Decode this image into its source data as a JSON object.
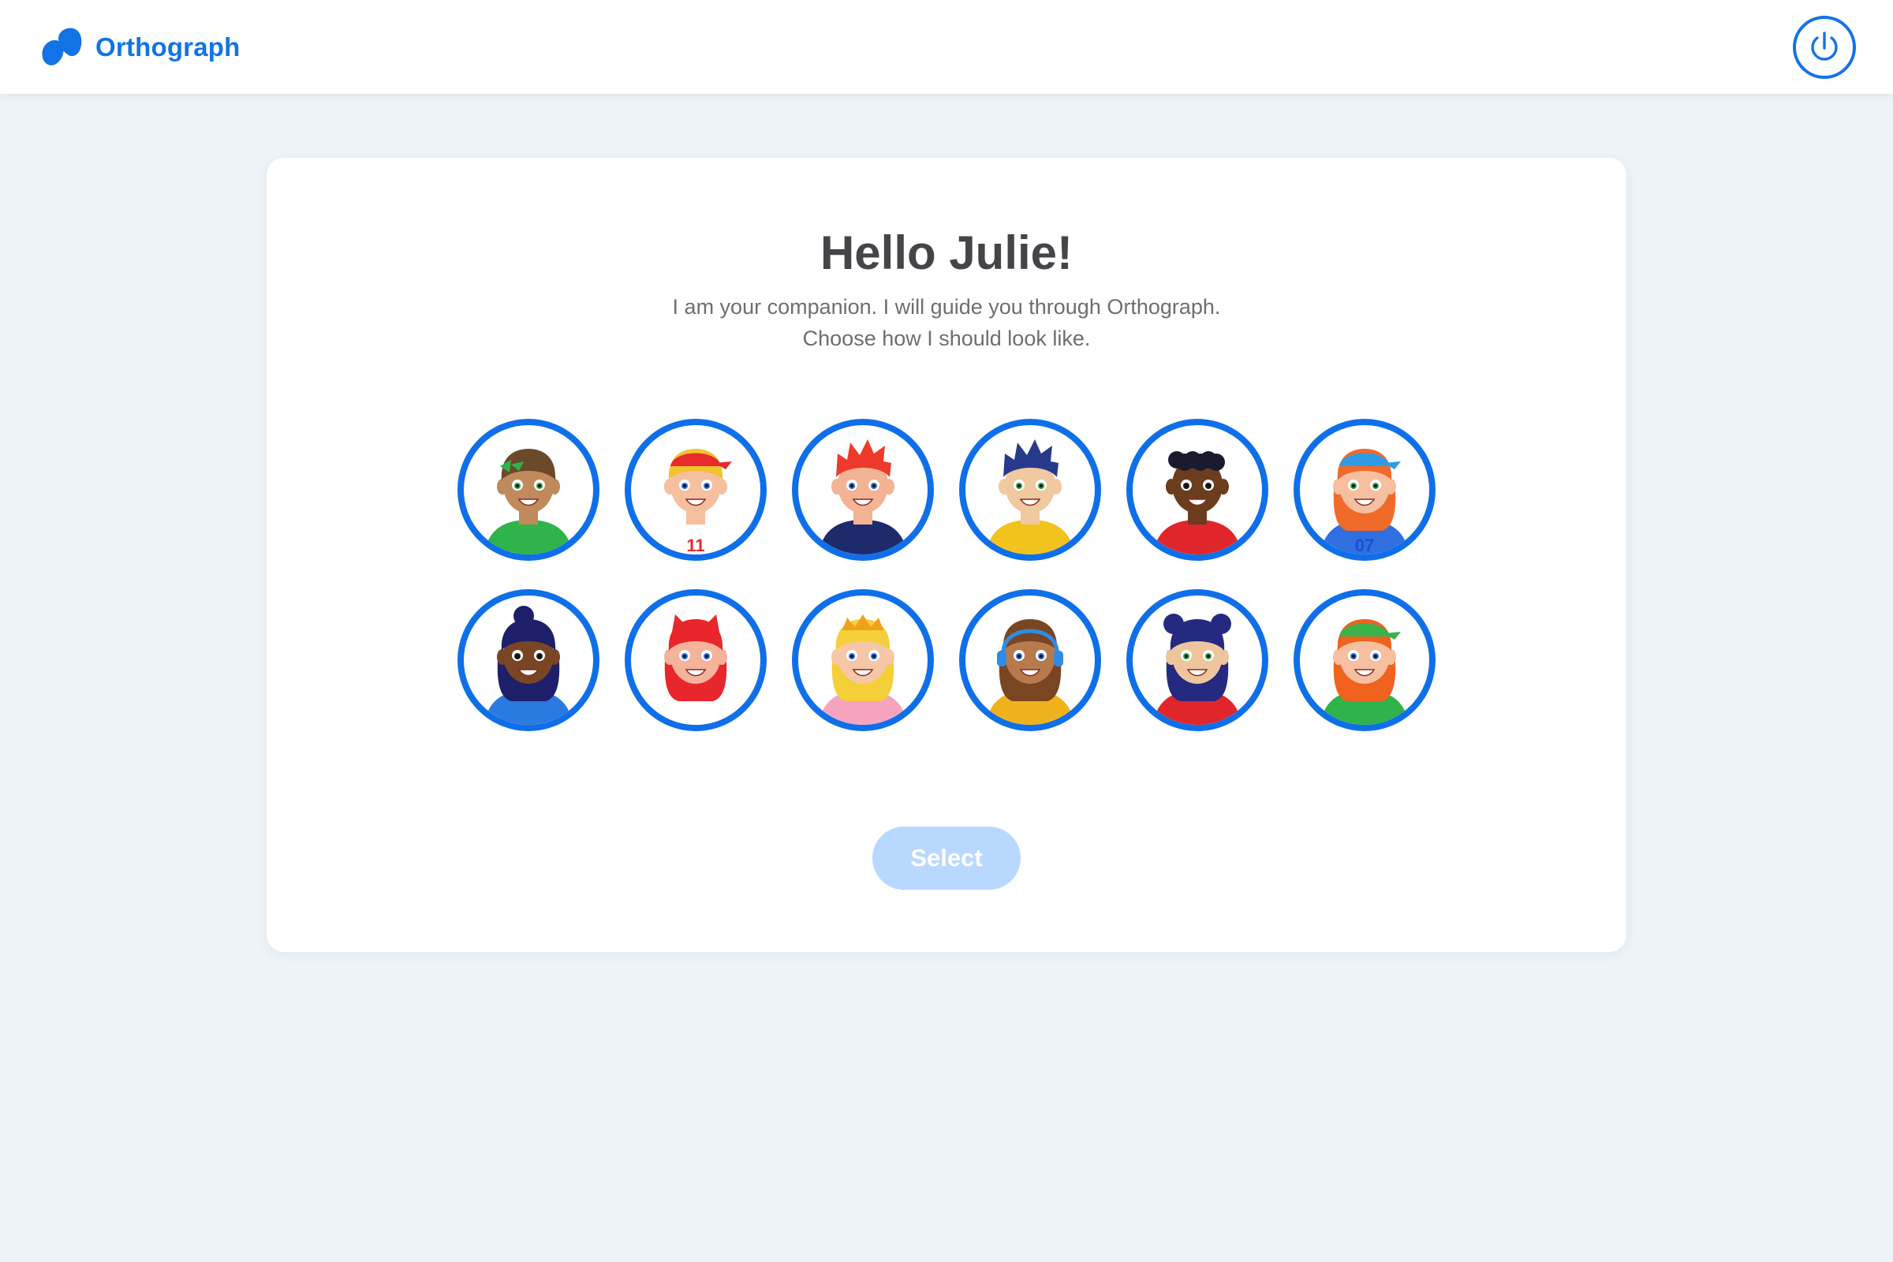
{
  "app": {
    "name": "Orthograph",
    "brand_color": "#1273e6",
    "power_icon": "power-icon"
  },
  "greeting": {
    "title": "Hello Julie!",
    "line1": "I am your companion. I will guide you through Orthograph.",
    "line2": "Choose how I should look like."
  },
  "avatars": [
    {
      "skin": "#c08a5c",
      "hair": "#6b4a2a",
      "top": "#2fb34a",
      "accent": "#2fb34a",
      "eyes": "#2e9e4a",
      "style": "bow"
    },
    {
      "skin": "#f6bfa0",
      "hair": "#f2c230",
      "top": "#ffffff",
      "accent": "#e52b2b",
      "eyes": "#2a6fd6",
      "style": "cap-side",
      "jersey": "11"
    },
    {
      "skin": "#f3b394",
      "hair": "#ee3a2a",
      "top": "#1d2a6b",
      "accent": "#ffffff",
      "eyes": "#2a6fd6",
      "style": "spiky"
    },
    {
      "skin": "#f0c9a0",
      "hair": "#273a8c",
      "top": "#f2c21d",
      "accent": "#3fb24a",
      "eyes": "#2e9e4a",
      "style": "spiky"
    },
    {
      "skin": "#6b3c1e",
      "hair": "#1b1b2e",
      "top": "#e0262b",
      "accent": "#b01e22",
      "eyes": "#1b1b1b",
      "style": "curly"
    },
    {
      "skin": "#f6bfa0",
      "hair": "#f06a2a",
      "top": "#2f6fe0",
      "accent": "#2f9be6",
      "eyes": "#2e9e4a",
      "style": "cap",
      "jersey": "07"
    },
    {
      "skin": "#7a4524",
      "hair": "#1d1f6a",
      "top": "#2a7ae0",
      "accent": "#ffffff",
      "eyes": "#1b1b1b",
      "style": "bun"
    },
    {
      "skin": "#f4b39a",
      "hair": "#e8262b",
      "top": "#ffffff",
      "accent": "#e8262b",
      "eyes": "#2a6fd6",
      "style": "cat"
    },
    {
      "skin": "#f6c7a6",
      "hair": "#f5cf3a",
      "top": "#f6a3c0",
      "accent": "#f0a11a",
      "eyes": "#2a6fd6",
      "style": "crown"
    },
    {
      "skin": "#b77a4c",
      "hair": "#7a4522",
      "top": "#f0b21c",
      "accent": "#2f8be6",
      "eyes": "#2a6fd6",
      "style": "headphones"
    },
    {
      "skin": "#eec69d",
      "hair": "#252a80",
      "top": "#e0262b",
      "accent": "#f5c21d",
      "eyes": "#2e9e4a",
      "style": "buns"
    },
    {
      "skin": "#f6bfa0",
      "hair": "#f0621e",
      "top": "#2fb34a",
      "accent": "#3bb24a",
      "eyes": "#2a6fd6",
      "style": "cap-back"
    }
  ],
  "actions": {
    "select_label": "Select",
    "select_color": "#b9d8ff"
  }
}
